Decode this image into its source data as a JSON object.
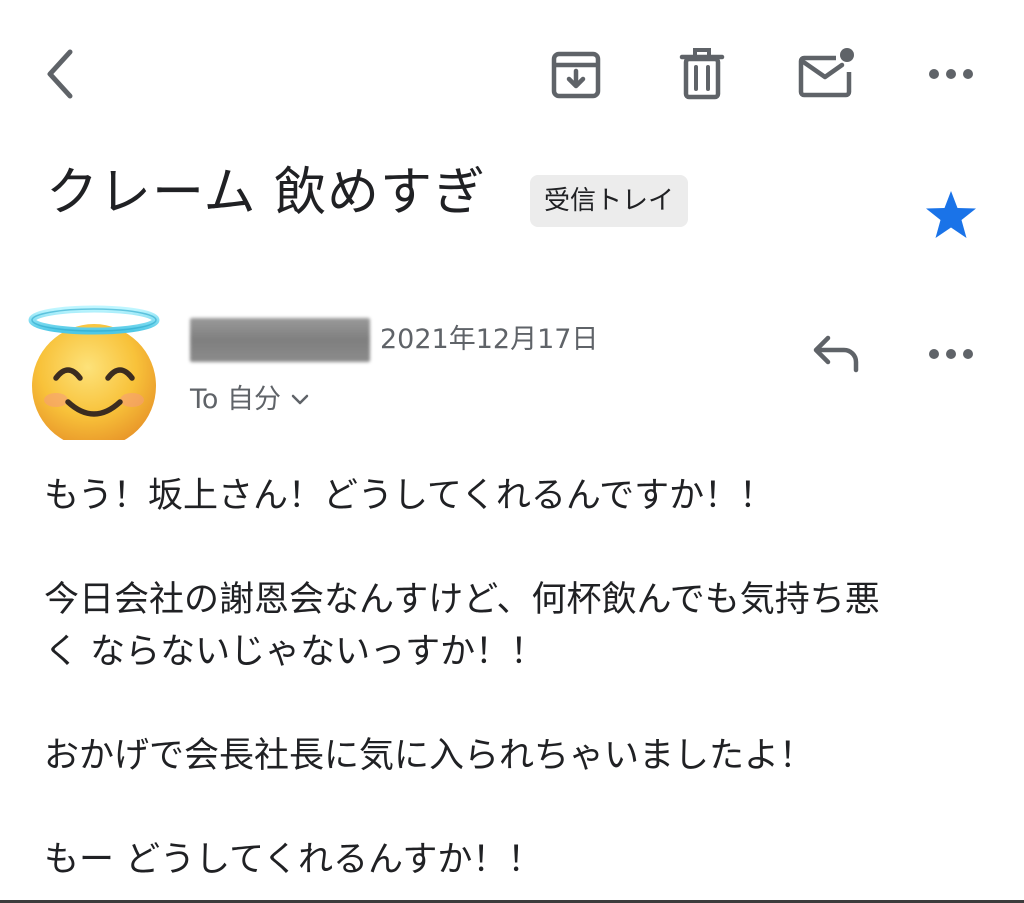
{
  "toolbar": {
    "back_icon": "chevron-left-icon",
    "archive_icon": "archive-icon",
    "delete_icon": "trash-icon",
    "mark_unread_icon": "mail-unread-icon",
    "more_icon": "more-horizontal-icon"
  },
  "subject": {
    "title": "クレーム 飲めすぎ",
    "label": "受信トレイ",
    "starred": true,
    "star_color": "#1a73e8"
  },
  "message": {
    "sender_name_redacted": true,
    "avatar_emoji": "smiling-face-with-halo",
    "date": "2021年12月17日",
    "recipient": "To 自分",
    "reply_icon": "reply-icon",
    "more_icon": "more-horizontal-icon",
    "body": [
      "もう！坂上さん！どうしてくれるんですか！！",
      "今日会社の謝恩会なんすけど、何杯飲んでも気持ち悪",
      "く ならないじゃないっすか！！",
      "おかげで会長社長に気に入られちゃいましたよ！",
      "もー どうしてくれるんすか！！"
    ]
  }
}
